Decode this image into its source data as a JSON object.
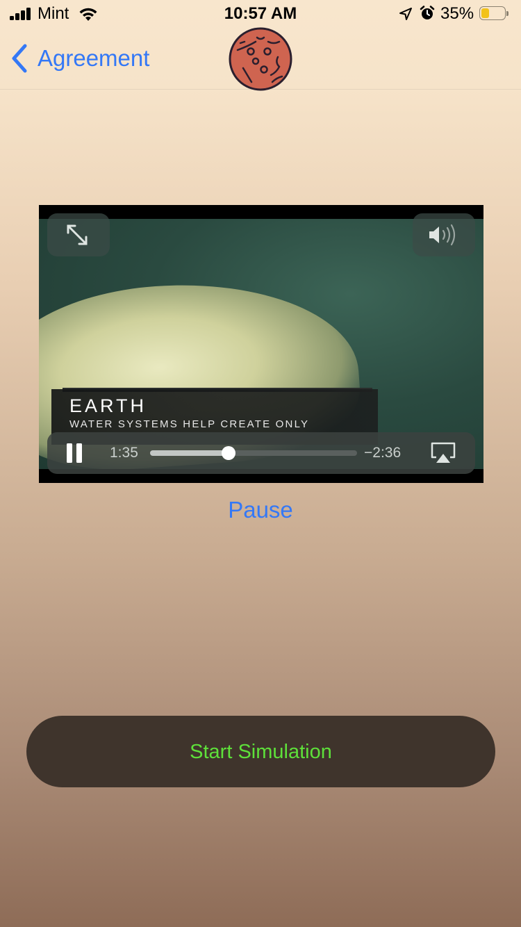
{
  "status_bar": {
    "carrier": "Mint",
    "time": "10:57 AM",
    "battery_percent": "35%",
    "battery_level": 0.35,
    "icons": [
      "cellular-signal-icon",
      "wifi-icon",
      "location-arrow-icon",
      "alarm-clock-icon",
      "battery-icon"
    ]
  },
  "nav": {
    "back_label": "Agreement",
    "logo": "planet-icon"
  },
  "video": {
    "title": "EARTH",
    "subtitle": "WATER SYSTEMS HELP CREATE ONLY",
    "elapsed": "1:35",
    "remaining": "−2:36",
    "progress": 0.38,
    "controls": [
      "fullscreen-icon",
      "volume-icon",
      "pause-icon",
      "airplay-icon"
    ]
  },
  "pause_label": "Pause",
  "start_button": {
    "label": "Start Simulation"
  },
  "colors": {
    "link_blue": "#3478f6",
    "button_bg": "#3f342c",
    "button_text": "#5ee03a",
    "battery_fill": "#f2c21a",
    "planet_fill": "#cf6450"
  }
}
